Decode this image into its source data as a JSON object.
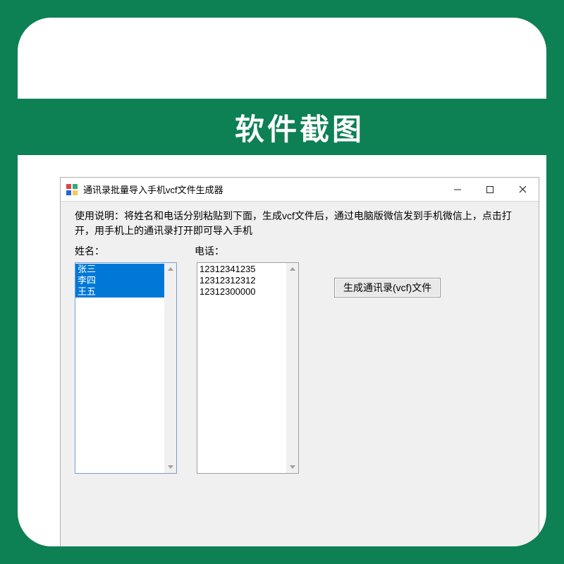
{
  "banner": "软件截图",
  "window": {
    "title": "通讯录批量导入手机vcf文件生成器",
    "instructions": "使用说明：将姓名和电话分别粘贴到下面，生成vcf文件后，通过电脑版微信发到手机微信上，点击打开，用手机上的通讯录打开即可导入手机",
    "name_label": "姓名：",
    "phone_label": "电话：",
    "names": [
      "张三",
      "李四",
      "王五"
    ],
    "phones": [
      "12312341235",
      "12312312312",
      "12312300000"
    ],
    "generate_button": "生成通讯录(vcf)文件"
  }
}
